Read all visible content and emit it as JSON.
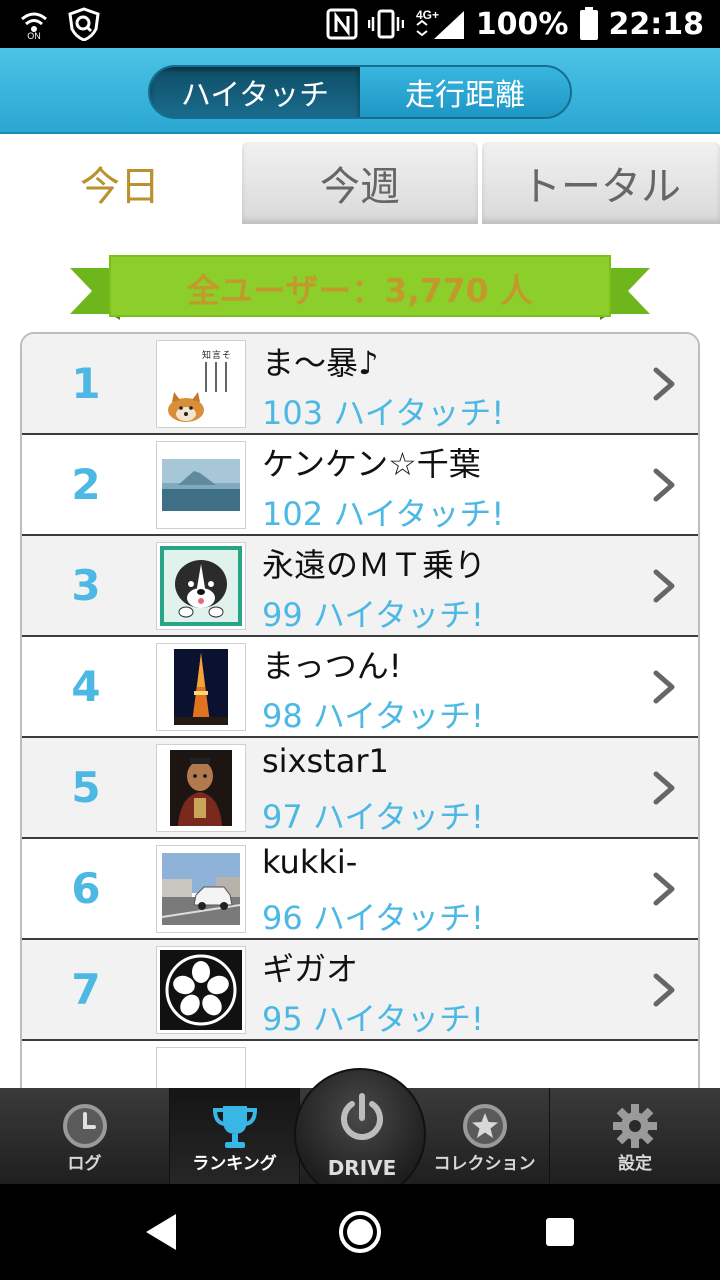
{
  "status_bar": {
    "battery": "100%",
    "time": "22:18",
    "network": "4G+",
    "icons": [
      "wifi-on-icon",
      "shield-app-icon",
      "nfc-icon",
      "vibrate-icon",
      "signal-icon",
      "battery-icon"
    ]
  },
  "header": {
    "segments": [
      {
        "label": "ハイタッチ",
        "active": true
      },
      {
        "label": "走行距離",
        "active": false
      }
    ]
  },
  "tabs": [
    {
      "label": "今日",
      "active": true
    },
    {
      "label": "今週",
      "active": false
    },
    {
      "label": "トータル",
      "active": false
    }
  ],
  "banner": {
    "text": "全ユーザー：3,770 人"
  },
  "ranking": [
    {
      "rank": "1",
      "name": "ま〜暴♪",
      "score": "103 ハイタッチ!",
      "avatar": "shiba-dog-calligraphy"
    },
    {
      "rank": "2",
      "name": "ケンケン☆千葉",
      "score": "102 ハイタッチ!",
      "avatar": "mount-fuji"
    },
    {
      "rank": "3",
      "name": "永遠のＭＴ乗り",
      "score": "99 ハイタッチ!",
      "avatar": "cartoon-dog"
    },
    {
      "rank": "4",
      "name": "まっつん!",
      "score": "98 ハイタッチ!",
      "avatar": "tokyo-tower-night"
    },
    {
      "rank": "5",
      "name": "sixstar1",
      "score": "97 ハイタッチ!",
      "avatar": "samurai-figure"
    },
    {
      "rank": "6",
      "name": "kukki-",
      "score": "96 ハイタッチ!",
      "avatar": "white-car"
    },
    {
      "rank": "7",
      "name": "ギガオ",
      "score": "95 ハイタッチ!",
      "avatar": "family-crest"
    }
  ],
  "bottom_nav": [
    {
      "label": "ログ",
      "icon": "clock-icon",
      "active": false
    },
    {
      "label": "ランキング",
      "icon": "trophy-icon",
      "active": true
    },
    {
      "label": "DRIVE",
      "icon": "power-icon",
      "active": false
    },
    {
      "label": "コレクション",
      "icon": "star-medal-icon",
      "active": false
    },
    {
      "label": "設定",
      "icon": "gear-icon",
      "active": false
    }
  ],
  "colors": {
    "accent": "#4db8e3",
    "gold": "#c29a2c",
    "header": "#2aa7d2",
    "banner_green": "#8ccf2a"
  }
}
